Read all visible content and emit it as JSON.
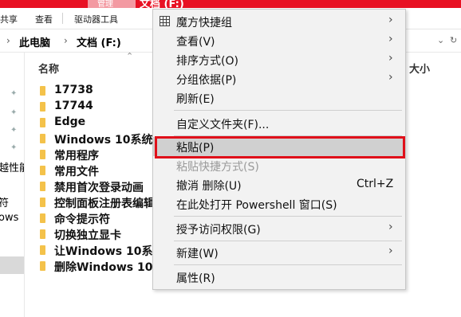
{
  "window": {
    "title": "文档 (F:)",
    "context_tab": "管理"
  },
  "ribbon_tabs": [
    "共享",
    "查看",
    "驱动器工具"
  ],
  "address": {
    "items": [
      "此电脑",
      "文档 (F:)"
    ]
  },
  "left_pane": {
    "labels": [
      "越性能",
      "符",
      "ows"
    ]
  },
  "columns": {
    "name": "名称",
    "size": "大小"
  },
  "files": [
    "17738",
    "17744",
    "Edge",
    "Windows 10系统",
    "常用程序",
    "常用文件",
    "禁用首次登录动画",
    "控制面板注册表编辑",
    "命令提示符",
    "切换独立显卡",
    "让Windows 10系",
    "删除Windows 10"
  ],
  "context_menu": {
    "items": [
      {
        "label": "魔方快捷组",
        "icon": "grid-icon",
        "has_submenu": true
      },
      {
        "label": "查看(V)",
        "has_submenu": true
      },
      {
        "label": "排序方式(O)",
        "has_submenu": true
      },
      {
        "label": "分组依据(P)",
        "has_submenu": true
      },
      {
        "label": "刷新(E)"
      },
      {
        "label": "自定义文件夹(F)..."
      },
      {
        "label": "粘贴(P)",
        "highlighted": true
      },
      {
        "label": "粘贴快捷方式(S)",
        "disabled": true
      },
      {
        "label": "撤消 删除(U)",
        "shortcut": "Ctrl+Z"
      },
      {
        "label": "在此处打开 Powershell 窗口(S)"
      },
      {
        "label": "授予访问权限(G)",
        "has_submenu": true
      },
      {
        "label": "新建(W)",
        "has_submenu": true
      },
      {
        "label": "属性(R)"
      }
    ]
  },
  "colors": {
    "title_bar": "#e81123",
    "highlight_border": "#e0101a",
    "folder": "#f4c24a",
    "menu_bg": "#f2f2f2"
  }
}
